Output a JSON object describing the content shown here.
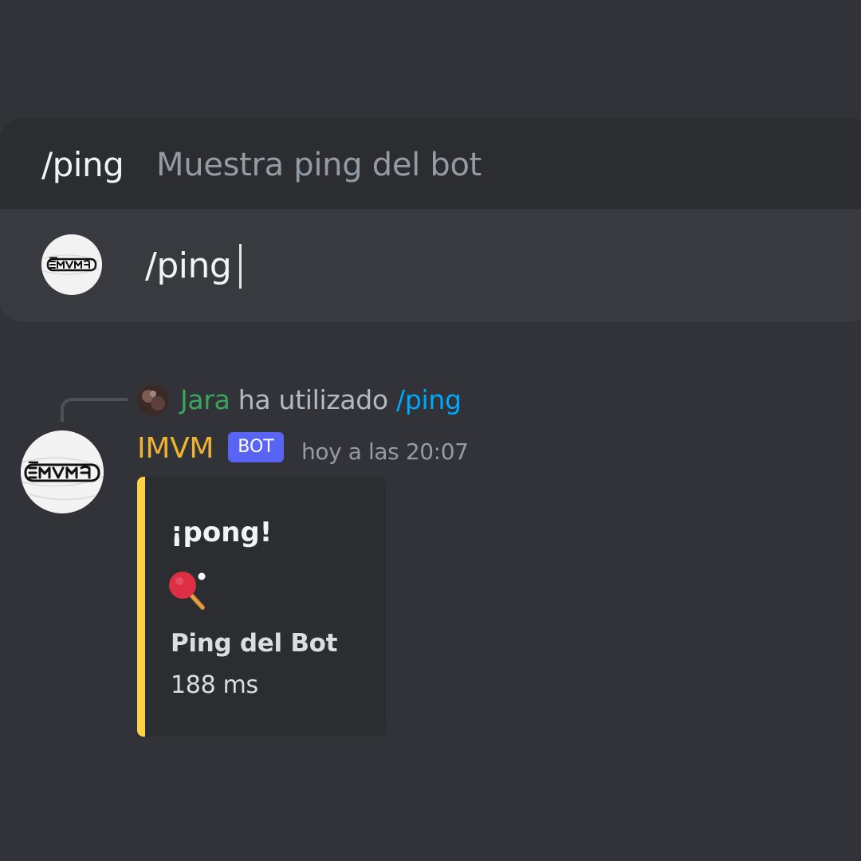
{
  "autocomplete": {
    "command": "/ping",
    "description": "Muestra ping del bot"
  },
  "composer": {
    "value": "/ping"
  },
  "message": {
    "reply": {
      "user": "Jara",
      "action": "ha utilizado",
      "command": "/ping"
    },
    "author": "IMVM",
    "bot_tag": "BOT",
    "timestamp": "hoy a las 20:07",
    "embed": {
      "title": "¡pong!",
      "emoji_icon": "ping-pong-icon",
      "field_name": "Ping del Bot",
      "field_value": "188 ms",
      "accent_color": "#fed246"
    }
  },
  "colors": {
    "background": "#313338",
    "panel": "#383a40",
    "suggestion": "#2b2d31",
    "author": "#f0b232",
    "reply_user": "#3ba55d",
    "reply_command": "#00a8fc",
    "bot_tag": "#5865f2"
  }
}
